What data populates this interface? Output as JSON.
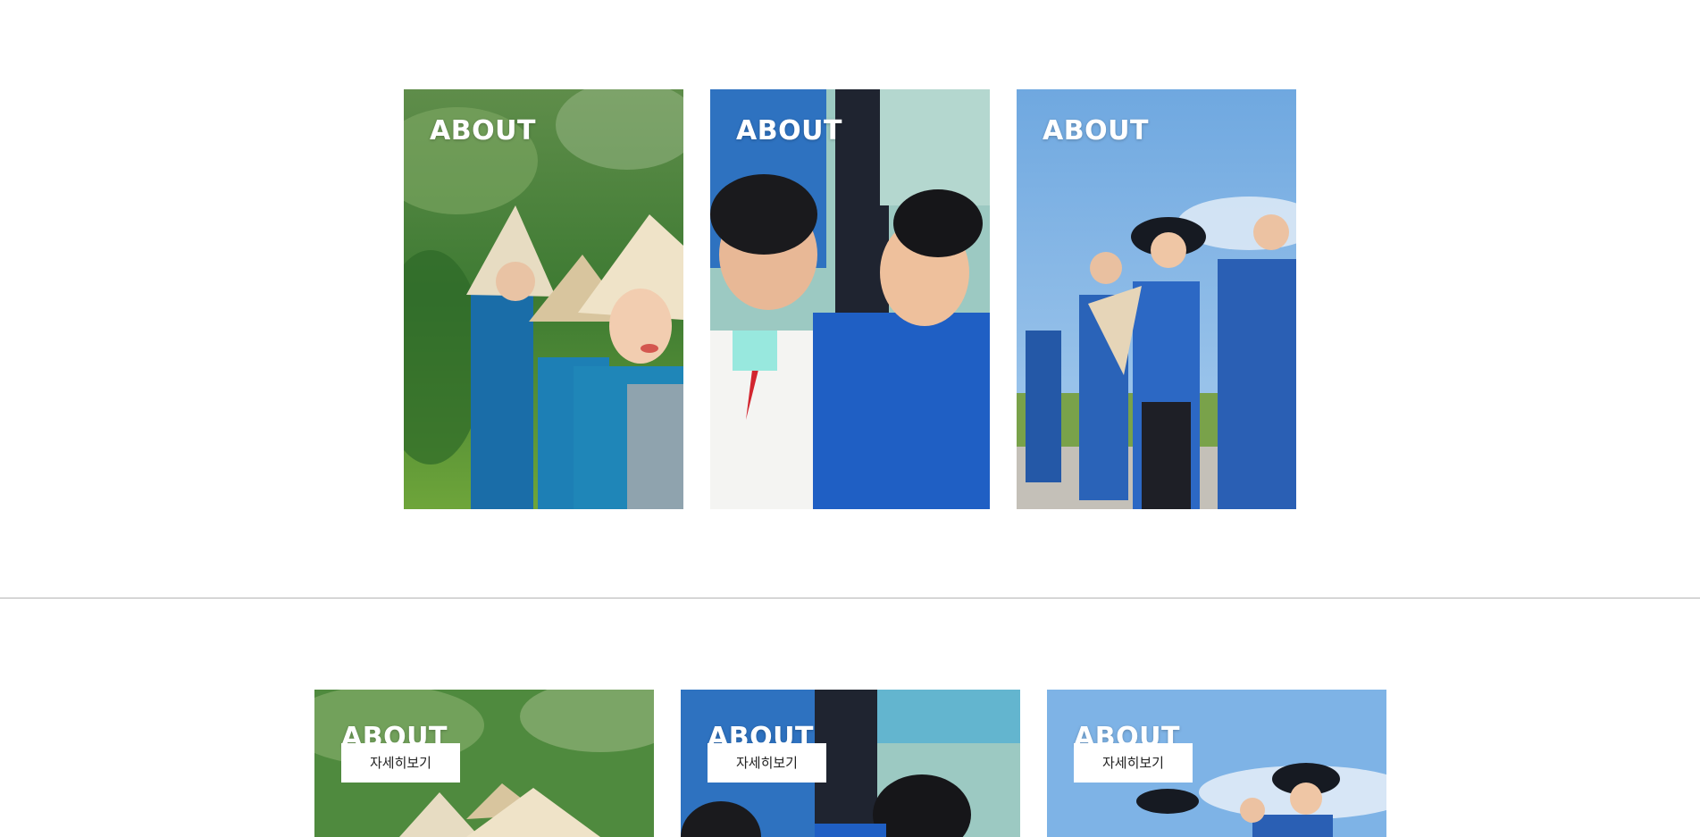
{
  "top_cards": [
    {
      "title": "ABOUT"
    },
    {
      "title": "ABOUT"
    },
    {
      "title": "ABOUT"
    }
  ],
  "bottom_cards": [
    {
      "title": "ABOUT",
      "button_label": "자세히보기"
    },
    {
      "title": "ABOUT",
      "button_label": "자세히보기"
    },
    {
      "title": "ABOUT",
      "button_label": "자세히보기"
    }
  ],
  "colors": {
    "background": "#ffffff",
    "divider": "#b4b4b4",
    "uniform_blue": "#1f5fc4",
    "sky_blue": "#6fa8e0",
    "foliage_green": "#3d7a32"
  }
}
